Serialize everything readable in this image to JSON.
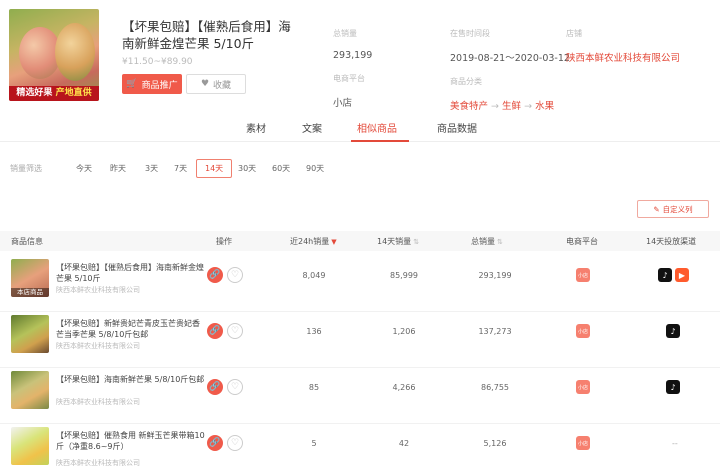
{
  "product": {
    "title": "【坏果包赔】【催熟后食用】海南新鲜金煌芒果 5/10斤",
    "price": "¥11.50~¥89.90",
    "banner_left": "精选好果",
    "banner_right": "产地直供",
    "primary_button": "商品推广",
    "secondary_button": "收藏",
    "meta": {
      "sales_label": "总销量",
      "sales_value": "293,199",
      "period_label": "在售时间段",
      "period_value": "2019-08-21～2020-03-12",
      "shop_label": "店铺",
      "shop_value": "陕西本鲜农业科技有限公司",
      "platform_label": "电商平台",
      "platform_value": "小店",
      "category_label": "商品分类",
      "category": [
        "美食特产",
        "生鲜",
        "水果"
      ]
    }
  },
  "tabs": [
    "素材",
    "文案",
    "相似商品",
    "商品数据"
  ],
  "active_tab": 2,
  "filter": {
    "label": "销量筛选",
    "days": [
      "今天",
      "昨天",
      "3天",
      "7天",
      "14天",
      "30天",
      "60天",
      "90天"
    ],
    "active_index": 4
  },
  "custom_button": "自定义列",
  "table": {
    "headers": [
      "商品信息",
      "操作",
      "近24h销量",
      "14天销量",
      "总销量",
      "电商平台",
      "14天投放渠道"
    ],
    "rows": [
      {
        "title": "【坏果包赔】【催熟后食用】海南新鲜金煌芒果 5/10斤",
        "shop": "陕西本鲜农业科技有限公司",
        "thumb_tag": "本店商品",
        "sales24h": "8,049",
        "sales14d": "85,999",
        "total": "293,199",
        "platform": "小店",
        "channels": [
          "douyin",
          "kuaishou"
        ]
      },
      {
        "title": "【坏果包赔】新鲜贵妃芒青皮玉芒贵妃香芒当季芒果 5/8/10斤包邮",
        "shop": "陕西本鲜农业科技有限公司",
        "thumb_tag": "",
        "sales24h": "136",
        "sales14d": "1,206",
        "total": "137,273",
        "platform": "小店",
        "channels": [
          "douyin"
        ]
      },
      {
        "title": "【坏果包赔】海南新鲜芒果 5/8/10斤包邮",
        "shop": "陕西本鲜农业科技有限公司",
        "thumb_tag": "",
        "sales24h": "85",
        "sales14d": "4,266",
        "total": "86,755",
        "platform": "小店",
        "channels": [
          "douyin"
        ]
      },
      {
        "title": "【坏果包赔】催熟食用 新鲜玉芒果带箱10斤（净重8.6~9斤）",
        "shop": "陕西本鲜农业科技有限公司",
        "thumb_tag": "",
        "sales24h": "5",
        "sales14d": "42",
        "total": "5,126",
        "platform": "小店",
        "channels": []
      }
    ]
  },
  "colors": {
    "accent": "#e34a3a",
    "button_red": "#f05a4a"
  }
}
